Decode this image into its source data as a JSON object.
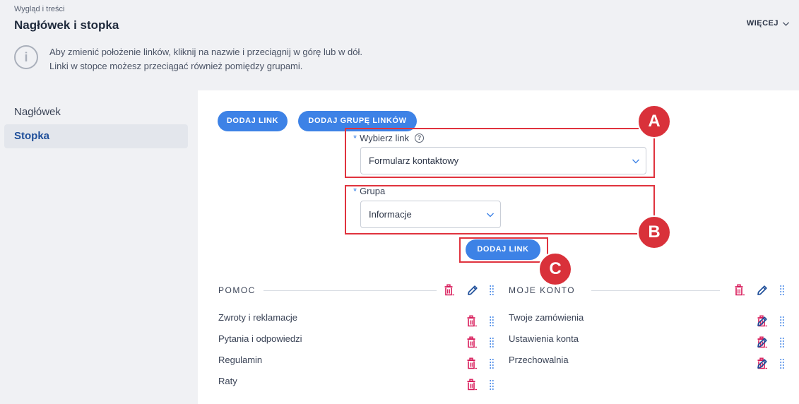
{
  "header": {
    "breadcrumb": "Wygląd i treści",
    "title": "Nagłówek i stopka",
    "more_label": "WIĘCEJ"
  },
  "info": {
    "line1": "Aby zmienić położenie linków, kliknij na nazwie i przeciągnij w górę lub w dół.",
    "line2": "Linki w stopce możesz przeciągać również pomiędzy grupami."
  },
  "sidebar": {
    "items": [
      {
        "label": "Nagłówek",
        "active": false
      },
      {
        "label": "Stopka",
        "active": true
      }
    ]
  },
  "toolbar": {
    "add_link_label": "DODAJ LINK",
    "add_group_label": "DODAJ GRUPĘ LINKÓW"
  },
  "form": {
    "link_label": "Wybierz link",
    "link_value": "Formularz kontaktowy",
    "group_label": "Grupa",
    "group_value": "Informacje",
    "required_mark": "*",
    "submit_label": "DODAJ LINK"
  },
  "badges": {
    "a": "A",
    "b": "B",
    "c": "C"
  },
  "groups": [
    {
      "title": "POMOC",
      "links": [
        "Zwroty i reklamacje",
        "Pytania i odpowiedzi",
        "Regulamin",
        "Raty"
      ]
    },
    {
      "title": "MOJE KONTO",
      "links": [
        "Twoje zamówienia",
        "Ustawienia konta",
        "Przechowalnia"
      ]
    }
  ],
  "colors": {
    "accent": "#3d82e6",
    "delete": "#d81b5a",
    "edit": "#1f4f9a",
    "highlight": "#e0333e"
  },
  "icons": [
    "info-icon",
    "chevron-down-icon",
    "help-icon",
    "trash-icon",
    "pencil-icon",
    "drag-handle-icon"
  ]
}
